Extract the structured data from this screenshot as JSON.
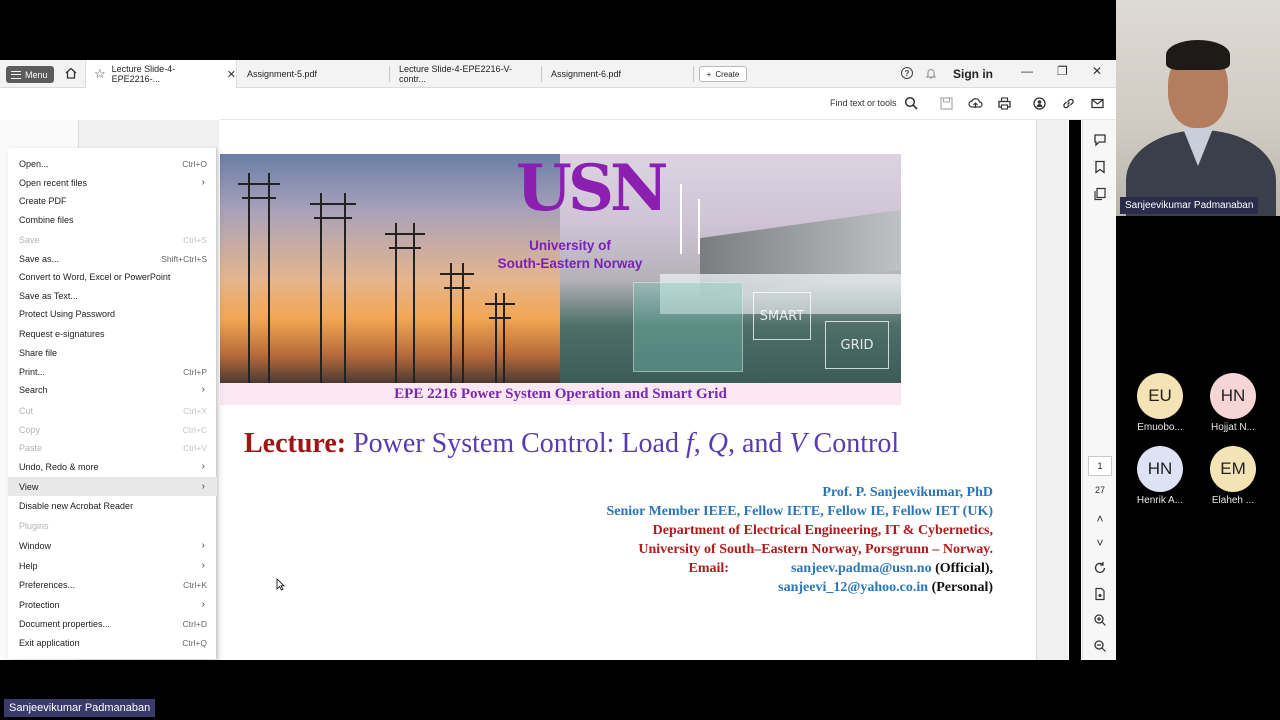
{
  "acrobat": {
    "menu_button_label": "Menu",
    "tabs": [
      {
        "label": "Lecture Slide-4-EPE2216-..."
      },
      {
        "label": "Assignment-5.pdf"
      },
      {
        "label": "Lecture Slide-4-EPE2216-V-contr..."
      },
      {
        "label": "Assignment-6.pdf"
      }
    ],
    "create_label": "Create",
    "signin_label": "Sign in",
    "find_placeholder": "Find text or tools"
  },
  "menu": {
    "items": [
      {
        "label": "Open...",
        "shortcut": "Ctrl+O",
        "submenu": false,
        "disabled": false
      },
      {
        "label": "Open recent files",
        "shortcut": "",
        "submenu": true,
        "disabled": false
      },
      {
        "label": "Create PDF",
        "shortcut": "",
        "submenu": false,
        "disabled": false
      },
      {
        "label": "Combine files",
        "shortcut": "",
        "submenu": false,
        "disabled": false
      },
      {
        "label": "Save",
        "shortcut": "Ctrl+S",
        "submenu": false,
        "disabled": true
      },
      {
        "label": "Save as...",
        "shortcut": "Shift+Ctrl+S",
        "submenu": false,
        "disabled": false
      },
      {
        "label": "Convert to Word, Excel or PowerPoint",
        "shortcut": "",
        "submenu": false,
        "disabled": false
      },
      {
        "label": "Save as Text...",
        "shortcut": "",
        "submenu": false,
        "disabled": false
      },
      {
        "label": "Protect Using Password",
        "shortcut": "",
        "submenu": false,
        "disabled": false
      },
      {
        "label": "Request e-signatures",
        "shortcut": "",
        "submenu": false,
        "disabled": false
      },
      {
        "label": "Share file",
        "shortcut": "",
        "submenu": false,
        "disabled": false
      },
      {
        "label": "Print...",
        "shortcut": "Ctrl+P",
        "submenu": false,
        "disabled": false
      },
      {
        "label": "Search",
        "shortcut": "",
        "submenu": true,
        "disabled": false
      },
      {
        "label": "Cut",
        "shortcut": "Ctrl+X",
        "submenu": false,
        "disabled": true
      },
      {
        "label": "Copy",
        "shortcut": "Ctrl+C",
        "submenu": false,
        "disabled": true
      },
      {
        "label": "Paste",
        "shortcut": "Ctrl+V",
        "submenu": false,
        "disabled": true
      },
      {
        "label": "Undo, Redo & more",
        "shortcut": "",
        "submenu": true,
        "disabled": false
      },
      {
        "label": "View",
        "shortcut": "",
        "submenu": true,
        "disabled": false,
        "highlight": true
      },
      {
        "label": "Disable new Acrobat Reader",
        "shortcut": "",
        "submenu": false,
        "disabled": false
      },
      {
        "label": "Plugins",
        "shortcut": "",
        "submenu": false,
        "disabled": true
      },
      {
        "label": "Window",
        "shortcut": "",
        "submenu": true,
        "disabled": false
      },
      {
        "label": "Help",
        "shortcut": "",
        "submenu": true,
        "disabled": false
      },
      {
        "label": "Preferences...",
        "shortcut": "Ctrl+K",
        "submenu": false,
        "disabled": false
      },
      {
        "label": "Protection",
        "shortcut": "",
        "submenu": true,
        "disabled": false
      },
      {
        "label": "Document properties...",
        "shortcut": "Ctrl+D",
        "submenu": false,
        "disabled": false
      },
      {
        "label": "Exit application",
        "shortcut": "Ctrl+Q",
        "submenu": false,
        "disabled": false
      }
    ]
  },
  "slide": {
    "logo_text": "USN",
    "university_line1": "University of",
    "university_line2": "South-Eastern Norway",
    "smart_label": "SMART",
    "grid_label": "GRID",
    "course_bar": "EPE 2216 Power System Operation and Smart Grid",
    "lecture_label": "Lecture:",
    "title_part1": "Power System Control: Load ",
    "title_f": "f",
    "title_comma1": ", ",
    "title_q": "Q",
    "title_comma2": ", and ",
    "title_v": "V",
    "title_part2": " Control",
    "author": "Prof. P. Sanjeevikumar, PhD",
    "memberships": "Senior Member IEEE, Fellow IETE, Fellow IE, Fellow IET (UK)",
    "department": "Department of Electrical Engineering, IT & Cybernetics,",
    "university": "University of South–Eastern Norway, Porsgrunn – Norway.",
    "email_label": "Email:",
    "email_official": "sanjeev.padma@usn.no",
    "email_official_tag": "(Official),",
    "email_personal": "sanjeevi_12@yahoo.co.in",
    "email_personal_tag": "(Personal)"
  },
  "pager": {
    "current": "1",
    "total": "27"
  },
  "meeting": {
    "presenter_name": "Sanjeevikumar Padmanaban",
    "participants": [
      {
        "initials": "EU",
        "name": "Emuobo...",
        "color": "#f4e3b5"
      },
      {
        "initials": "HN",
        "name": "Hojjat N...",
        "color": "#f5d5d6"
      },
      {
        "initials": "HN",
        "name": "Henrik A...",
        "color": "#dfe1f5"
      },
      {
        "initials": "EM",
        "name": "Elaheh ...",
        "color": "#f4e3b5"
      }
    ],
    "speaker_label": "Sanjeevikumar Padmanaban"
  }
}
